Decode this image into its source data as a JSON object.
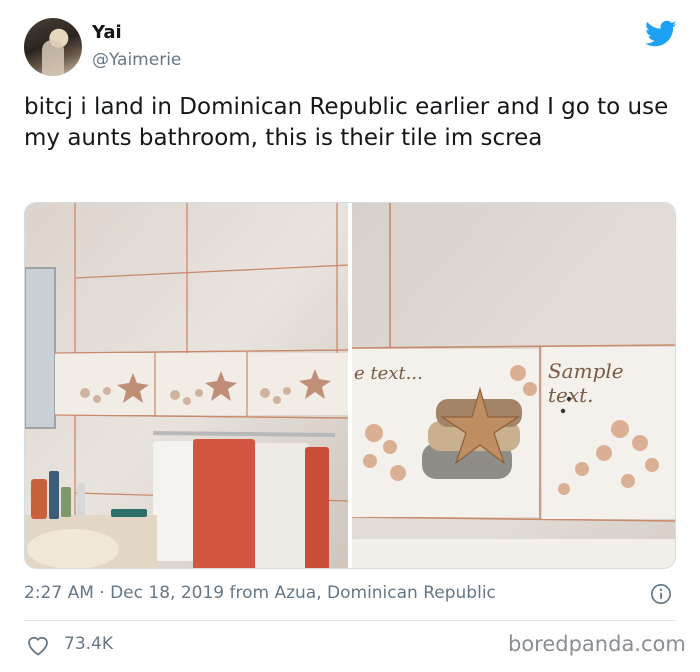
{
  "author": {
    "name": "Yai",
    "handle": "@Yaimerie"
  },
  "tweet": {
    "text": "bitcj i land in Dominican Republic earlier and I go to use my aunts bathroom, this is their tile im screa",
    "meta": "2:27 AM · Dec 18, 2019 from Azua, Dominican Republic",
    "likes": "73.4K"
  },
  "media": {
    "tile_text": "Sample text",
    "tile_text_left": "Sample text",
    "tile_text_right_partial": "e text...",
    "tile_text_right_main": "Sample text."
  },
  "watermark": "boredpanda.com",
  "colors": {
    "twitter_blue": "#1da1f2",
    "meta_gray": "#657786",
    "tile_base": "#e8e3de",
    "grout": "#c98a6a"
  },
  "icons": [
    "twitter-bird-icon",
    "info-icon",
    "heart-icon"
  ]
}
